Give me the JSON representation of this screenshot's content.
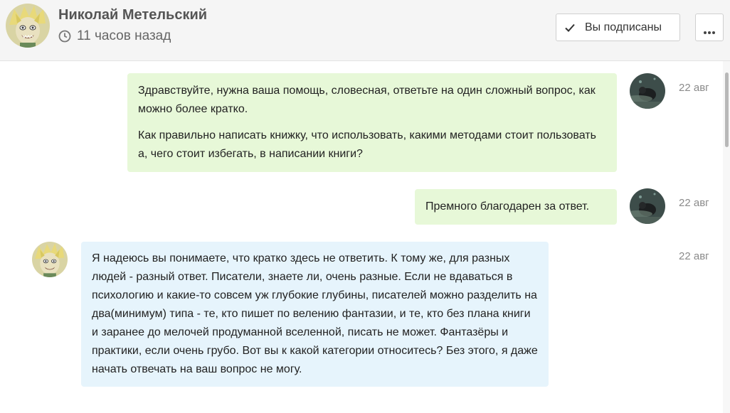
{
  "header": {
    "name": "Николай Метельский",
    "status": "11 часов назад",
    "subscribe_label": "Вы подписаны"
  },
  "messages": [
    {
      "direction": "out",
      "paragraphs": [
        "Здравствуйте, нужна ваша помощь, словесная, ответьте на один сложный вопрос, как можно более кратко.",
        "Как правильно написать книжку,  что использовать, какими методами стоит пользовать а, чего стоит избегать, в написании книги?"
      ],
      "date": "22 авг"
    },
    {
      "direction": "out",
      "paragraphs": [
        "Премного благодарен за ответ."
      ],
      "date": "22 авг"
    },
    {
      "direction": "in",
      "paragraphs": [
        "Я надеюсь вы понимаете, что кратко здесь не ответить. К тому же, для разных людей - разный ответ. Писатели, знаете ли, очень разные. Если не вдаваться в психологию и какие-то совсем уж глубокие глубины, писателей можно разделить на два(минимум) типа - те, кто пишет по велению фантазии, и те, кто без плана книги и заранее до мелочей продуманной вселенной, писать не может. Фантазёры и практики, если очень грубо. Вот вы к какой категории относитесь? Без этого, я даже начать отвечать на ваш вопрос не могу."
      ],
      "date": "22 авг"
    }
  ],
  "colors": {
    "outgoing_bubble": "#e7f8d8",
    "incoming_bubble": "#e6f4fc",
    "header_bg": "#f5f5f5"
  },
  "icons": {
    "status": "clock-icon",
    "subscribe": "check-icon",
    "more": "dots-icon"
  }
}
